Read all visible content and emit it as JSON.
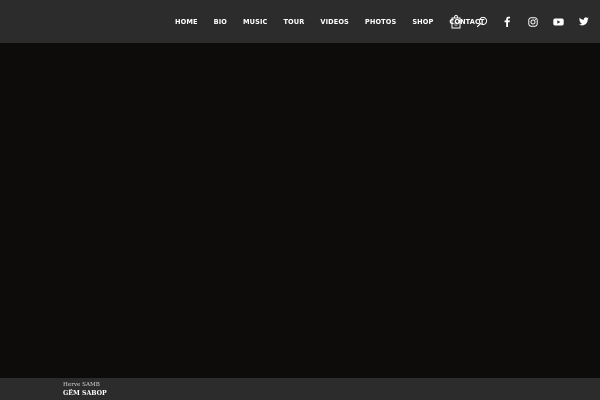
{
  "header": {
    "nav": [
      {
        "label": "HOME"
      },
      {
        "label": "BIO"
      },
      {
        "label": "MUSIC"
      },
      {
        "label": "TOUR"
      },
      {
        "label": "VIDEOS"
      },
      {
        "label": "PHOTOS"
      },
      {
        "label": "SHOP"
      },
      {
        "label": "CONTACT"
      }
    ],
    "cart_count": "0",
    "icons": [
      "shopping-bag-icon",
      "search-icon",
      "facebook-icon",
      "instagram-icon",
      "youtube-icon",
      "twitter-icon"
    ]
  },
  "player": {
    "artist": "Herve SAMB",
    "title": "GËM SABOP"
  },
  "colors": {
    "header_bg": "#2d2c2c",
    "page_bg": "#0d0c0b",
    "text": "#ffffff"
  }
}
